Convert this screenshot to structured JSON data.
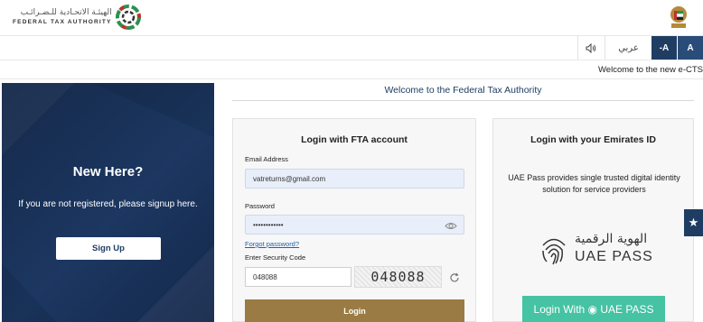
{
  "header": {
    "logo_arabic": "الهيئـة الاتحـادية للـضـرائـب",
    "logo_english": "FEDERAL TAX AUTHORITY",
    "logo_icon": "fta-logo-icon",
    "emblem_icon": "uae-emblem-icon"
  },
  "toolbar": {
    "speaker_icon": "speaker-icon",
    "language_label": "عربي",
    "font_decrease_label": "-A",
    "font_normal_label": "A"
  },
  "ticker": {
    "text": "Welcome to the new e-CTS"
  },
  "left_panel": {
    "heading": "New Here?",
    "note": "If you are not registered, please signup here.",
    "signup_label": "Sign Up"
  },
  "welcome_bar": {
    "text": "Welcome to the Federal Tax Authority"
  },
  "fta_login": {
    "title": "Login with FTA account",
    "email_label": "Email Address",
    "email_value": "vatreturns@gmail.com",
    "password_label": "Password",
    "password_value": "••••••••••••",
    "eye_icon": "eye-icon",
    "forgot_label": "Forgot password?",
    "security_label": "Enter Security Code",
    "security_value": "048088",
    "captcha_text": "048088",
    "refresh_icon": "refresh-icon",
    "login_label": "Login"
  },
  "uae_login": {
    "title": "Login with your Emirates ID",
    "description": "UAE Pass provides single trusted digital identity solution for service providers",
    "logo_arabic": "الهوية الرقمية",
    "logo_english": "UAE PASS",
    "fingerprint_icon": "fingerprint-icon",
    "button_label": "Login With ◉ UAE PASS"
  },
  "side_tab": {
    "star_icon": "star-icon",
    "star_glyph": "★"
  },
  "colors": {
    "navy": "#1f3d63",
    "gold": "#9a7b44",
    "uae_pass_green": "#45c3a3",
    "input_fill": "#e9effa"
  }
}
